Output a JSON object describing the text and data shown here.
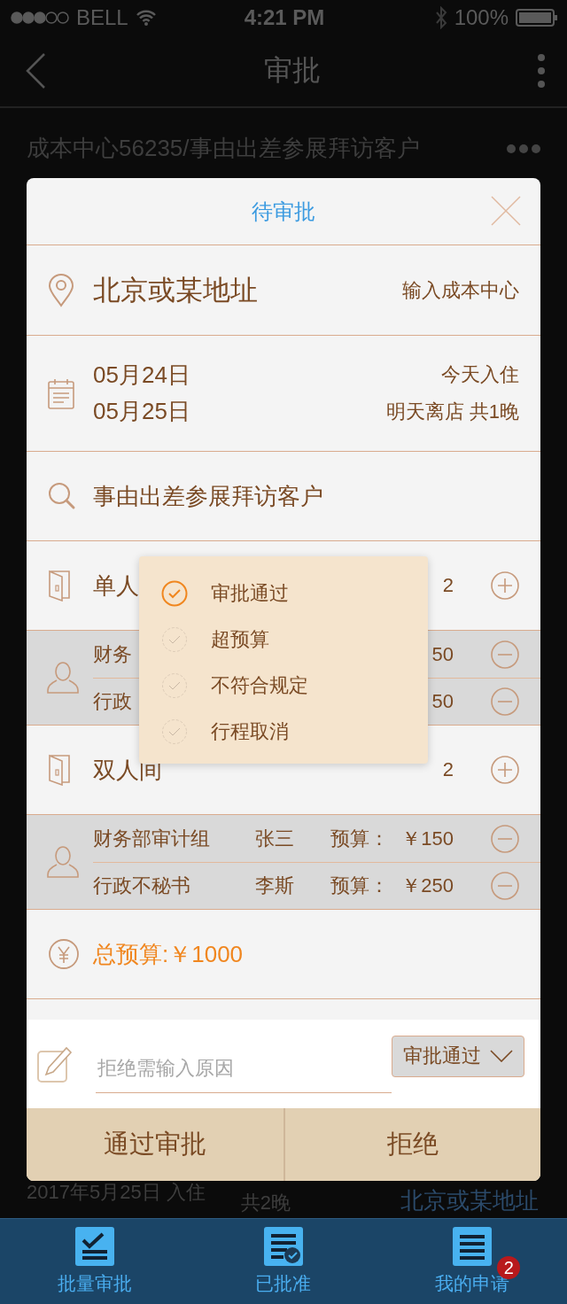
{
  "status_bar": {
    "carrier": "BELL",
    "time": "4:21 PM",
    "battery": "100%"
  },
  "nav": {
    "title": "审批"
  },
  "background_list": {
    "top_row": {
      "title": "成本中心56235/事由出差参展拜访客户"
    },
    "bottom_row": {
      "date": "2017年5月25日 入住",
      "nights": "共2晚",
      "address": "北京或某地址"
    }
  },
  "dialog": {
    "title": "待审批",
    "address": "北京或某地址",
    "cost_center": "输入成本中心",
    "check_in": "05月24日",
    "check_out": "05月25日",
    "check_in_note": "今天入住",
    "check_out_note": "明天离店 共1晚",
    "reason": "事由出差参展拜访客户",
    "rooms": [
      {
        "name": "单人",
        "count": "2",
        "guests": [
          {
            "dept": "财务",
            "amount": "50"
          },
          {
            "dept": "行政",
            "amount": "50"
          }
        ]
      },
      {
        "name": "双人间",
        "count": "2",
        "guests": [
          {
            "dept": "财务部审计组",
            "person": "张三",
            "budget_label": "预算：",
            "amount": "￥150"
          },
          {
            "dept": "行政不秘书",
            "person": "李斯",
            "budget_label": "预算：",
            "amount": "￥250"
          }
        ]
      }
    ],
    "total": "总预算:￥1000",
    "remark": {
      "placeholder": "拒绝需输入原因"
    },
    "status_select": "审批通过",
    "buttons": [
      "通过审批",
      "拒绝"
    ]
  },
  "popup": {
    "options": [
      {
        "label": "审批通过",
        "selected": true
      },
      {
        "label": "超预算",
        "selected": false
      },
      {
        "label": "不符合规定",
        "selected": false
      },
      {
        "label": "行程取消",
        "selected": false
      }
    ]
  },
  "tab_bar": [
    {
      "label": "批量审批",
      "kind": "batch"
    },
    {
      "label": "已批准",
      "kind": "approved"
    },
    {
      "label": "我的申请",
      "kind": "mine",
      "badge": "2"
    }
  ]
}
